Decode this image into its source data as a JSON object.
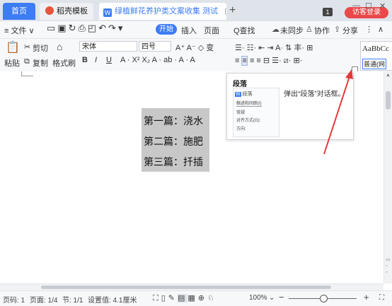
{
  "tabs": {
    "home": "首页",
    "template": "稻壳模板",
    "doc": "绿植鲜花养护类文案收集 测试"
  },
  "window": {
    "badge": "1",
    "login": "访客登录"
  },
  "menu": {
    "file": "≡ 文件 ∨",
    "start": "开始",
    "insert": "插入",
    "page": "页面",
    "search": "Q查找",
    "sync": "未同步",
    "collab": "协作",
    "share": "分享"
  },
  "toolbar": {
    "paste": "粘贴",
    "cut": "剪切",
    "copy": "复制",
    "format_painter": "格式刷",
    "font": "宋体",
    "size": "四号",
    "style_preview": "AaBbCc",
    "style_name": "普通(网"
  },
  "document": {
    "lines": [
      "第一篇：浇水",
      "第二篇：施肥",
      "第三篇：扦插"
    ]
  },
  "tooltip": {
    "title": "段落",
    "desc": "弹出“段落”对话框。",
    "mini_title": "段落",
    "mini_tab": "缩进和间距(I)",
    "mini_section": "常规",
    "mini_align": "对齐方式(G):",
    "mini_dir": "方向:"
  },
  "status": {
    "page": "页码: 1",
    "pages": "页面: 1/4",
    "section": "节: 1/1",
    "setting": "设置值: 4.1厘米",
    "zoom": "100%"
  },
  "colors": {
    "accent": "#3c7cf5",
    "arrow": "#e03a3a",
    "login": "#e84a4a"
  }
}
